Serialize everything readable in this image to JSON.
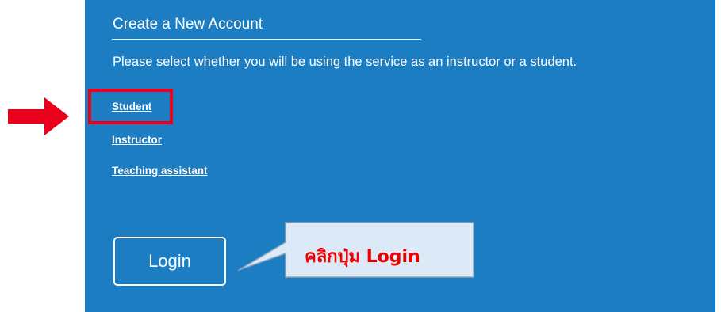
{
  "form": {
    "title": "Create a New Account",
    "subtitle": "Please select whether you will be using the service as an instructor or a student.",
    "options": [
      "Student",
      "Instructor",
      "Teaching assistant"
    ],
    "login_label": "Login"
  },
  "annotation": {
    "callout_text": "คลิกปุ่ม Login",
    "arrow_icon": "right-arrow-icon",
    "highlight_color": "#e8001c",
    "callout_text_color": "#ee0000",
    "callout_background": "#dce9f6"
  },
  "colors": {
    "panel_background": "#1d7dc2",
    "text": "#ffffff"
  }
}
